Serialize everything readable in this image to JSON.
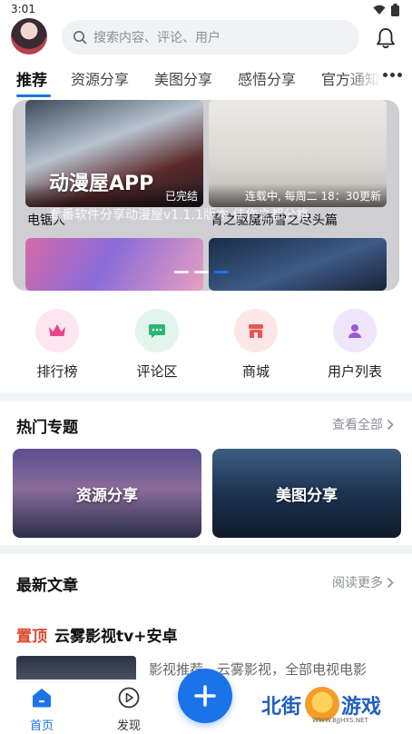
{
  "status_bar": {
    "time": "3:01"
  },
  "header": {
    "search_placeholder": "搜索内容、评论、用户"
  },
  "tabs": [
    {
      "label": "推荐",
      "active": true
    },
    {
      "label": "资源分享",
      "active": false
    },
    {
      "label": "美图分享",
      "active": false
    },
    {
      "label": "感悟分享",
      "active": false
    },
    {
      "label": "官方通知",
      "active": false
    }
  ],
  "banner": {
    "app_title": "动漫屋APP",
    "app_desc": "看番软件分享动漫屋v1.1.1版本 佳作之都分格",
    "items": [
      {
        "title": "电锯人",
        "status": "已完结"
      },
      {
        "title": "青之驱魔师雪之尽头篇",
        "status": "连载中, 每周二 18：30更新"
      }
    ],
    "active_index": 2,
    "slide_count": 3
  },
  "quick_entries": [
    {
      "label": "排行榜",
      "icon": "crown-icon",
      "bg": "#fde6ef",
      "fg": "#e8448a"
    },
    {
      "label": "评论区",
      "icon": "comment-icon",
      "bg": "#e3f4ec",
      "fg": "#2bb673"
    },
    {
      "label": "商城",
      "icon": "shop-icon",
      "bg": "#fde6e6",
      "fg": "#ef5350"
    },
    {
      "label": "用户列表",
      "icon": "user-icon",
      "bg": "#efe6fb",
      "fg": "#9b59d6"
    }
  ],
  "topics_section": {
    "title": "热门专题",
    "more_label": "查看全部",
    "items": [
      {
        "label": "资源分享"
      },
      {
        "label": "美图分享"
      }
    ]
  },
  "articles_section": {
    "title": "最新文章",
    "more_label": "阅读更多",
    "top_article": {
      "pin_label": "置顶",
      "title": "云雾影视tv+安卓",
      "summary": "影视推荐，云雾影视，全部电视电影"
    }
  },
  "bottom_nav": [
    {
      "label": "首页",
      "icon": "home-icon",
      "active": true
    },
    {
      "label": "发现",
      "icon": "play-circle-icon",
      "active": false
    }
  ],
  "watermark": {
    "text_a": "北街",
    "text_b": "游戏",
    "url": "WWW.BJJHXS.NET"
  },
  "colors": {
    "accent": "#1a73e8",
    "pin": "#e0482d"
  }
}
